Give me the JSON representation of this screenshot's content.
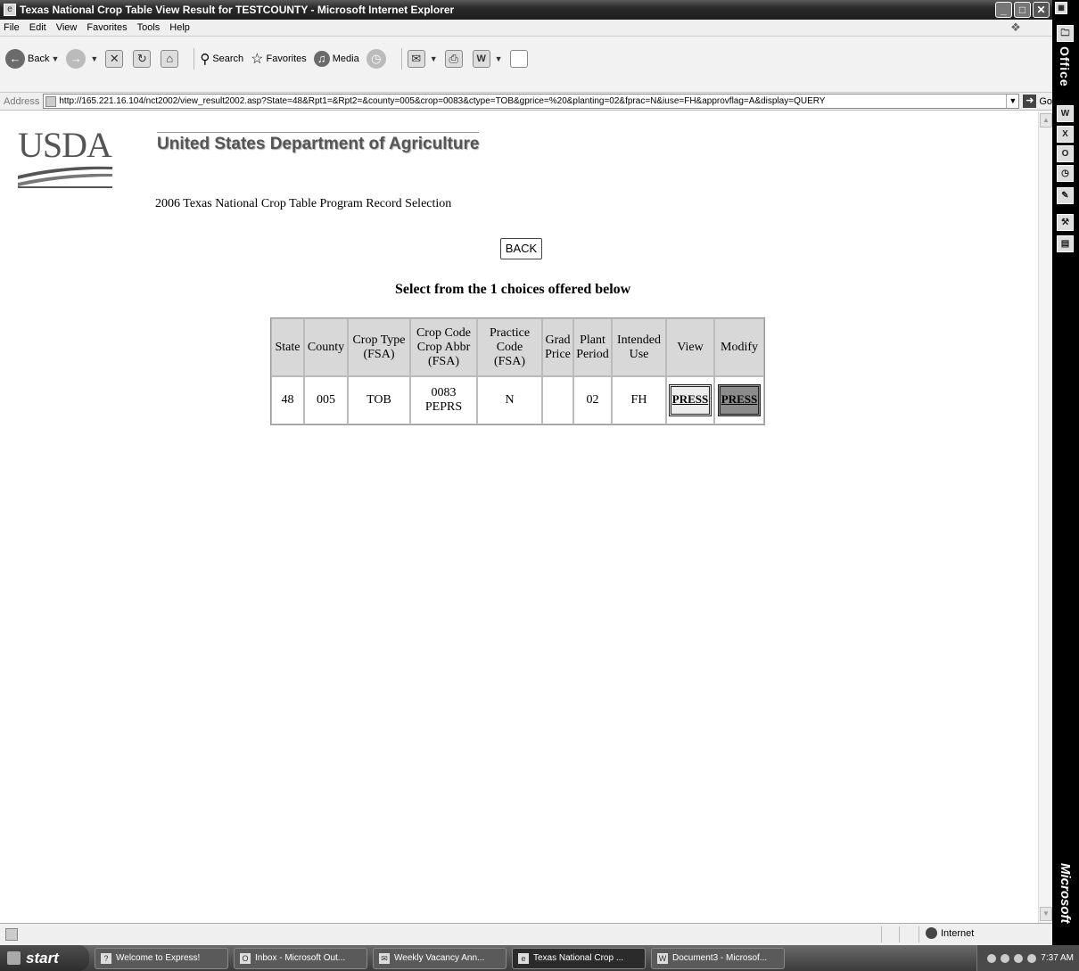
{
  "window": {
    "title": "Texas National Crop Table View Result for TESTCOUNTY - Microsoft Internet Explorer"
  },
  "menu": [
    "File",
    "Edit",
    "View",
    "Favorites",
    "Tools",
    "Help"
  ],
  "toolbar": {
    "back": "Back",
    "search": "Search",
    "favorites": "Favorites",
    "media": "Media"
  },
  "address": {
    "label": "Address",
    "url": "http://165.221.16.104/nct2002/view_result2002.asp?State=48&Rpt1=&Rpt2=&county=005&crop=0083&ctype=TOB&gprice=%20&planting=02&fprac=N&iuse=FH&approvflag=A&display=QUERY",
    "go": "Go"
  },
  "page": {
    "logo": "USDA",
    "agency": "United States Department of Agriculture",
    "subtitle": "2006 Texas National Crop Table Program Record Selection",
    "back_button": "BACK",
    "choices_text": "Select from the 1 choices offered below"
  },
  "table": {
    "headers": {
      "state": "State",
      "county": "County",
      "crop_type": "Crop Type (FSA)",
      "crop_code": "Crop Code Crop Abbr (FSA)",
      "practice": "Practice Code (FSA)",
      "grad_price": "Grad Price",
      "plant_period": "Plant Period",
      "intended_use": "Intended Use",
      "view": "View",
      "modify": "Modify"
    },
    "rows": [
      {
        "state": "48",
        "county": "005",
        "crop_type": "TOB",
        "crop_code": "0083",
        "crop_abbr": "PEPRS",
        "practice": "N",
        "grad_price": "",
        "plant_period": "02",
        "intended_use": "FH",
        "view": "PRESS",
        "modify": "PRESS"
      }
    ]
  },
  "status": {
    "zone": "Internet"
  },
  "officebar": {
    "title": "Office",
    "brand": "Microsoft"
  },
  "taskbar": {
    "start": "start",
    "tasks": [
      "Welcome to Express!",
      "Inbox - Microsoft Out...",
      "Weekly Vacancy Ann...",
      "Texas National Crop ...",
      "Document3 - Microsof..."
    ],
    "clock": "7:37 AM"
  }
}
